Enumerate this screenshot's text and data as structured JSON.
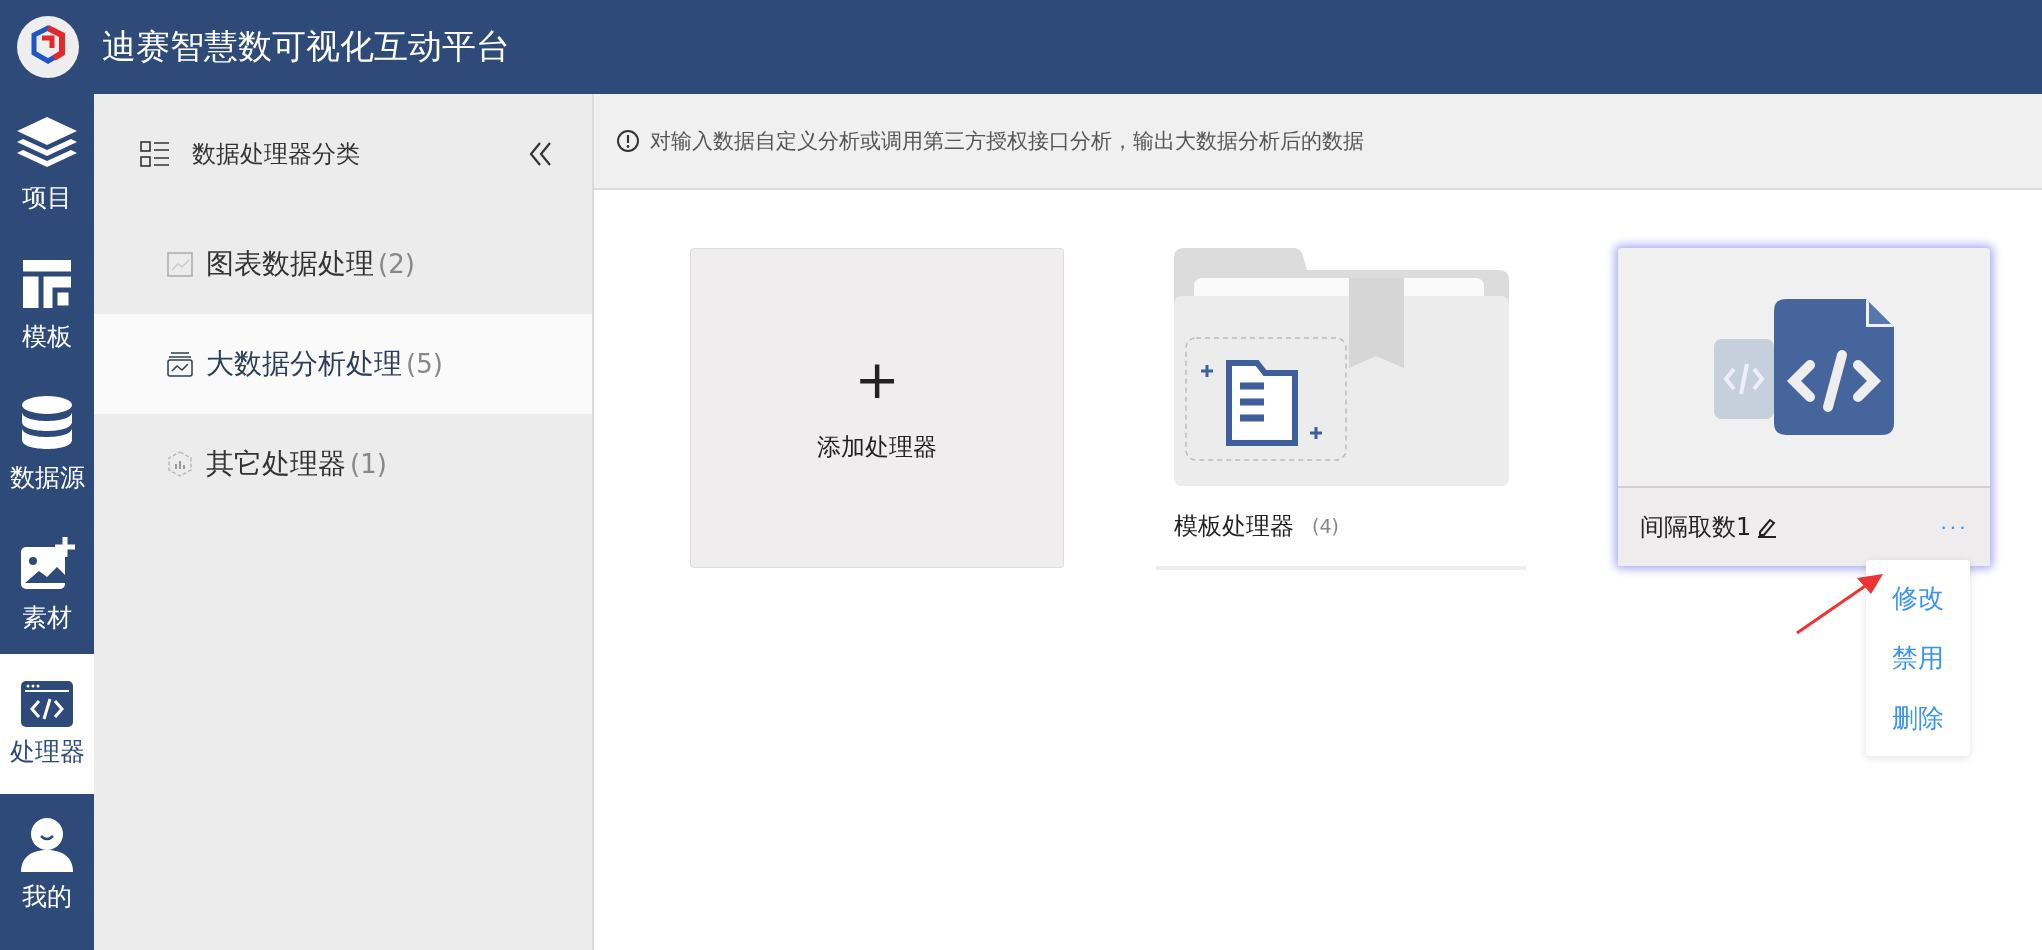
{
  "app": {
    "title": "迪赛智慧数可视化互动平台"
  },
  "nav": [
    {
      "label": "项目",
      "selected": false
    },
    {
      "label": "模板",
      "selected": false
    },
    {
      "label": "数据源",
      "selected": false
    },
    {
      "label": "素材",
      "selected": false
    },
    {
      "label": "处理器",
      "selected": true
    },
    {
      "label": "我的",
      "selected": false
    }
  ],
  "panel": {
    "title": "数据处理器分类",
    "categories": [
      {
        "label": "图表数据处理",
        "count": "(2)",
        "selected": false
      },
      {
        "label": "大数据分析处理",
        "count": "(5)",
        "selected": true
      },
      {
        "label": "其它处理器",
        "count": "(1)",
        "selected": false
      }
    ]
  },
  "notice": "对输入数据自定义分析或调用第三方授权接口分析，输出大数据分析后的数据",
  "cards": [
    {
      "kind": "add",
      "symbol": "+",
      "label": "添加处理器"
    },
    {
      "kind": "folder",
      "label": "模板处理器",
      "count": "(4)"
    },
    {
      "kind": "processor",
      "label": "间隔取数1",
      "more": "···",
      "selected": true
    }
  ],
  "menu": [
    {
      "label": "修改"
    },
    {
      "label": "禁用"
    },
    {
      "label": "删除"
    }
  ]
}
